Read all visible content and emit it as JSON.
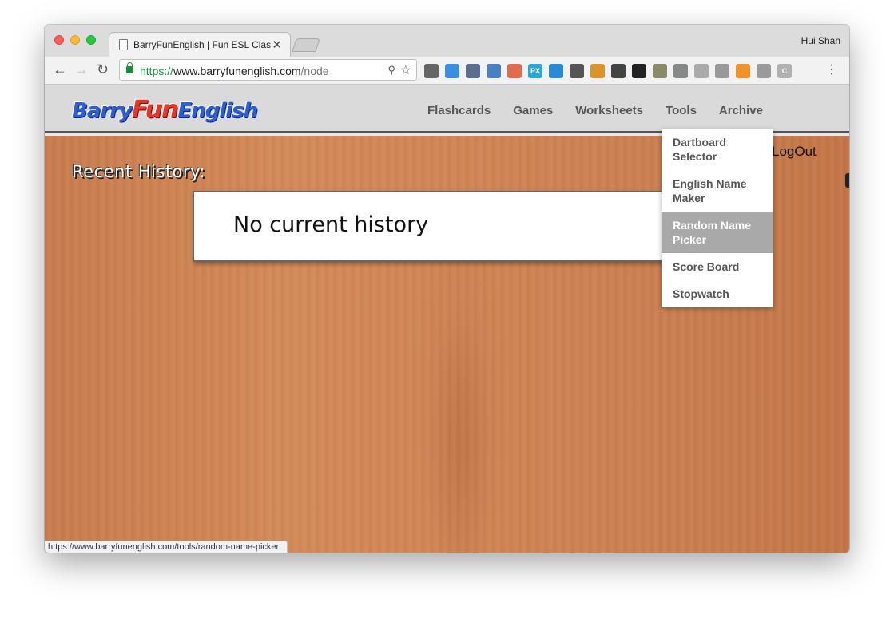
{
  "browser": {
    "tab_title": "BarryFunEnglish | Fun ESL Clas",
    "profile_name": "Hui Shan",
    "url_scheme": "https://",
    "url_host": "www.barryfunenglish.com",
    "url_path": "/node",
    "status_url": "https://www.barryfunenglish.com/tools/random-name-picker",
    "extensions": [
      {
        "name": "bug-extension-icon",
        "label": "",
        "color": "#666666"
      },
      {
        "name": "safari-extension-icon",
        "label": "",
        "color": "#3b8ee0"
      },
      {
        "name": "eyedropper-extension-icon",
        "label": "",
        "color": "#5a6f8f"
      },
      {
        "name": "download-tray-extension-icon",
        "label": "",
        "color": "#4a7fc1"
      },
      {
        "name": "note-extension-icon",
        "label": "",
        "color": "#e16b4f"
      },
      {
        "name": "px-extension-icon",
        "label": "PX",
        "color": "#2aa6d8"
      },
      {
        "name": "download-arrow-extension-icon",
        "label": "",
        "color": "#2a8ad8"
      },
      {
        "name": "recycle-extension-icon",
        "label": "",
        "color": "#555555"
      },
      {
        "name": "signpost-extension-icon",
        "label": "",
        "color": "#d9942b"
      },
      {
        "name": "cart-extension-icon",
        "label": "",
        "color": "#444444"
      },
      {
        "name": "circle-download-extension-icon",
        "label": "",
        "color": "#222222"
      },
      {
        "name": "puzzle-extension-icon",
        "label": "",
        "color": "#8a8a6a"
      },
      {
        "name": "window-extension-icon",
        "label": "",
        "color": "#888888"
      },
      {
        "name": "disc-extension-icon",
        "label": "",
        "color": "#aaaaaa"
      },
      {
        "name": "grid-extension-icon",
        "label": "",
        "color": "#999999"
      },
      {
        "name": "rss-extension-icon",
        "label": "",
        "color": "#f0932b"
      },
      {
        "name": "arrow-down-extension-icon",
        "label": "",
        "color": "#9a9a9a"
      },
      {
        "name": "c-extension-icon",
        "label": "C",
        "color": "#b0b0b0"
      }
    ]
  },
  "site": {
    "logo": {
      "part1": "Barry",
      "part2": "Fun",
      "part3": "English"
    },
    "nav": [
      "Flashcards",
      "Games",
      "Worksheets",
      "Tools",
      "Archive"
    ],
    "tools_menu": [
      "Dartboard Selector",
      "English Name Maker",
      "Random Name Picker",
      "Score Board",
      "Stopwatch"
    ],
    "tools_menu_active": "Random Name Picker",
    "logout_label": "LogOut",
    "recent_history_title": "Recent History:",
    "history_empty_text": "No current history"
  },
  "colors": {
    "logo_blue": "#2d5fd3",
    "logo_red": "#e8372a",
    "wood": "#c97e50",
    "menu_highlight": "#a9a9a9"
  }
}
